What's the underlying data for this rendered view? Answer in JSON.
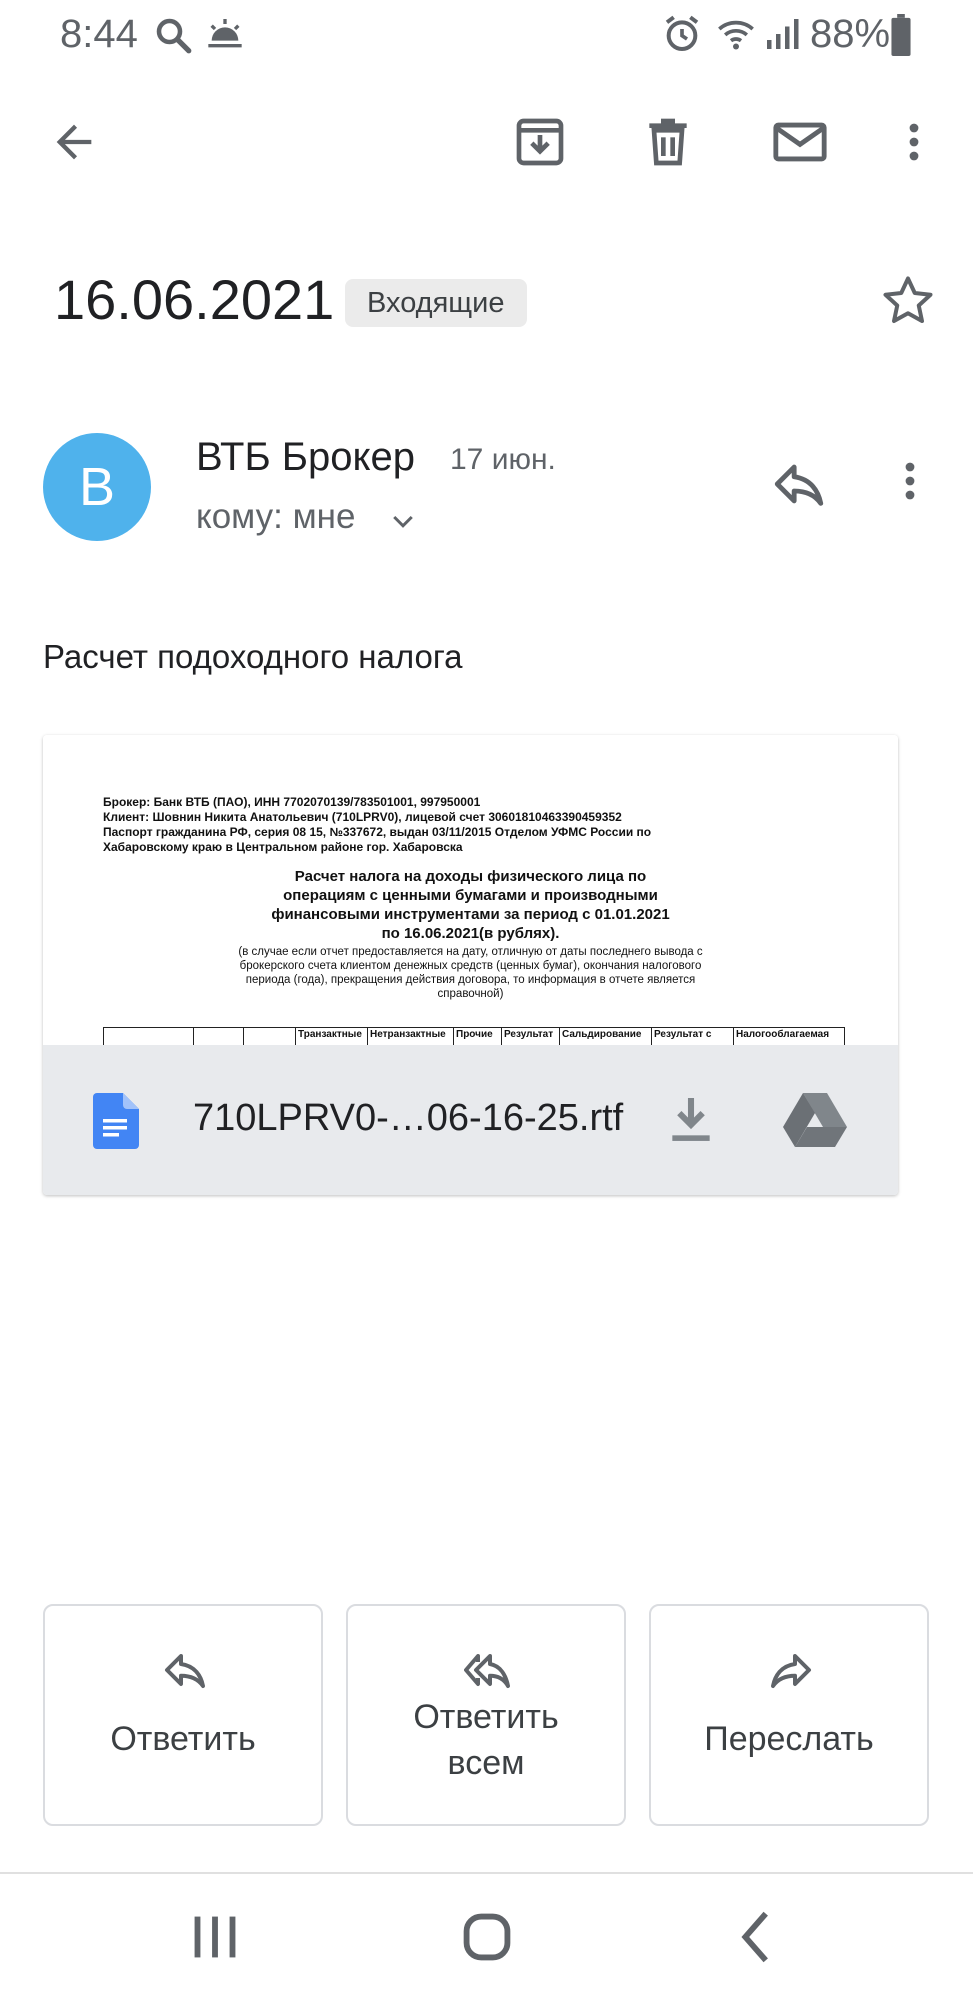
{
  "status_bar": {
    "time": "8:44",
    "battery": "88%",
    "icons": [
      "search-icon",
      "weather-icon",
      "alarm-icon",
      "wifi-icon",
      "signal-icon",
      "battery-icon"
    ]
  },
  "toolbar": {
    "icons": [
      "back-arrow-icon",
      "archive-icon",
      "trash-icon",
      "mark-unread-icon",
      "more-vert-icon"
    ]
  },
  "email": {
    "subject": "16.06.2021",
    "label": "Входящие",
    "sender": {
      "avatar_letter": "B",
      "avatar_color": "#4fb2ec",
      "name": "ВТБ Брокер",
      "date": "17 июн.",
      "recipient": "кому: мне"
    },
    "body": "Расчет подоходного налога"
  },
  "attachment": {
    "preview": {
      "lines": [
        "Брокер: Банк ВТБ (ПАО), ИНН 7702070139/783501001, 997950001",
        "Клиент: Шовнин Никита Анатольевич (710LPRV0), лицевой счет 30601810463390459352",
        "Паспорт гражданина РФ, серия 08 15, №337672, выдан 03/11/2015 Отделом УФМС России по",
        "Хабаровскому краю в Центральном районе гор. Хабаровска"
      ],
      "title_lines": [
        "Расчет налога на доходы физического лица по",
        "операциям с ценными бумагами и производными",
        "финансовыми инструментами за период с 01.01.2021",
        "по 16.06.2021(в рублях)."
      ],
      "note_lines": [
        "(в случае если отчет предоставляется на дату, отличную от даты последнего вывода с",
        "брокерского счета клиентом денежных средств (ценных бумаг), окончания налогового",
        "периода (года), прекращения действия договора, то информация в отчете является",
        "справочной)"
      ],
      "table_headers": [
        "Транзактные",
        "Нетранзактные",
        "Прочие",
        "Результат",
        "Сальдирование",
        "Результат с",
        "Налогооблагаемая"
      ]
    },
    "file_name": "710LPRV0-…06-16-25.rtf",
    "file_icon_color": "#4285f4"
  },
  "actions": {
    "reply": "Ответить",
    "reply_all_line1": "Ответить",
    "reply_all_line2": "всем",
    "forward": "Переслать"
  },
  "nav": {
    "icons": [
      "recent-apps-icon",
      "home-icon",
      "back-icon"
    ]
  }
}
